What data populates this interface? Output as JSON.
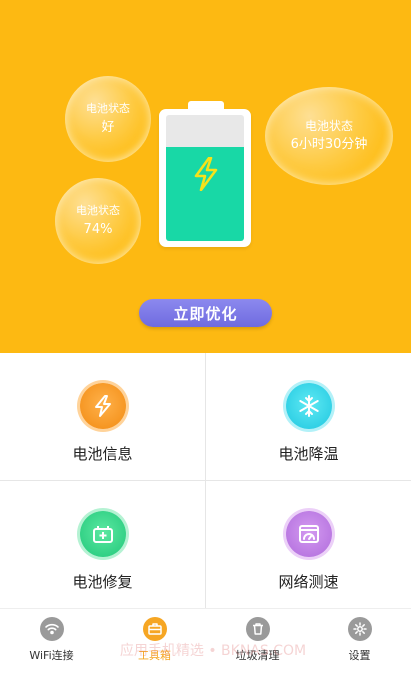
{
  "hero": {
    "bubbles": [
      {
        "label": "电池状态",
        "value": "好"
      },
      {
        "label": "电池状态",
        "value": "74%"
      },
      {
        "label": "电池状态",
        "value": "6小时30分钟"
      }
    ],
    "battery_level": 0.74,
    "optimize_button": "立即优化"
  },
  "grid": {
    "tiles": [
      {
        "label": "电池信息",
        "icon": "battery-info-icon"
      },
      {
        "label": "电池降温",
        "icon": "snowflake-icon"
      },
      {
        "label": "电池修复",
        "icon": "battery-repair-icon"
      },
      {
        "label": "网络测速",
        "icon": "speed-test-icon"
      }
    ]
  },
  "nav": {
    "items": [
      {
        "label": "WiFi连接",
        "icon": "wifi-icon",
        "active": false
      },
      {
        "label": "工具箱",
        "icon": "toolbox-icon",
        "active": true
      },
      {
        "label": "垃圾清理",
        "icon": "trash-icon",
        "active": false
      },
      {
        "label": "设置",
        "icon": "settings-icon",
        "active": false
      }
    ]
  },
  "watermark": "应用手机精选 • BKNAS.COM",
  "colors": {
    "hero_bg": "#FDB912",
    "battery_fill": "#18D8A6",
    "button": "#7673E6",
    "nav_active": "#F6A623"
  }
}
